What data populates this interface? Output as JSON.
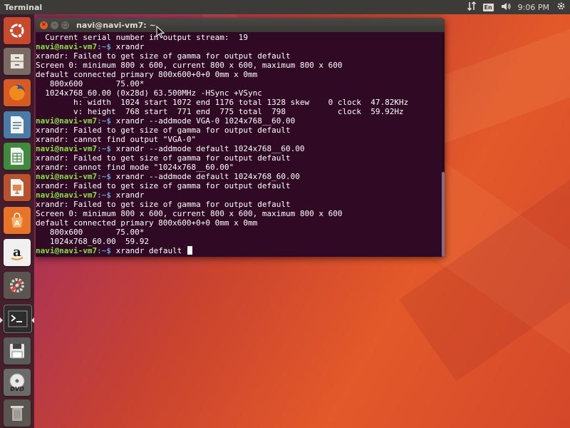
{
  "top_panel": {
    "app_title": "Terminal",
    "keyboard_layout": "En",
    "clock": "9:06 PM",
    "icons": [
      "network-transfer-icon",
      "keyboard-layout-icon",
      "volume-icon",
      "settings-gear-icon"
    ]
  },
  "launcher": {
    "items": [
      {
        "name": "ubuntu-dash",
        "icon": "ubuntu-logo-icon"
      },
      {
        "name": "files",
        "icon": "file-cabinet-icon"
      },
      {
        "name": "firefox",
        "icon": "firefox-icon"
      },
      {
        "name": "libreoffice-writer",
        "icon": "writer-document-icon"
      },
      {
        "name": "libreoffice-calc",
        "icon": "calc-spreadsheet-icon"
      },
      {
        "name": "libreoffice-impress",
        "icon": "impress-presentation-icon"
      },
      {
        "name": "ubuntu-software",
        "icon": "software-center-icon"
      },
      {
        "name": "amazon",
        "icon": "amazon-icon"
      },
      {
        "name": "system-settings",
        "icon": "settings-tools-icon"
      },
      {
        "name": "terminal",
        "icon": "terminal-icon"
      },
      {
        "name": "save-disk",
        "icon": "floppy-disk-icon"
      },
      {
        "name": "dvd",
        "icon": "dvd-icon",
        "label": "DVD"
      },
      {
        "name": "trash",
        "icon": "trash-icon"
      }
    ]
  },
  "terminal": {
    "title": "navi@navi-vm7: ~",
    "prompt_user": "navi@navi-vm7",
    "prompt_path": ":~$",
    "lines": [
      {
        "type": "out",
        "text": "  Current serial number in output stream:  19"
      },
      {
        "type": "cmd",
        "text": " xrandr"
      },
      {
        "type": "out",
        "text": "xrandr: Failed to get size of gamma for output default"
      },
      {
        "type": "out",
        "text": "Screen 0: minimum 800 x 600, current 800 x 600, maximum 800 x 600"
      },
      {
        "type": "out",
        "text": "default connected primary 800x600+0+0 0mm x 0mm"
      },
      {
        "type": "out",
        "text": "   800x600       75.00*"
      },
      {
        "type": "out",
        "text": "  1024x768_60.00 (0x28d) 63.500MHz -HSync +VSync"
      },
      {
        "type": "out",
        "text": "        h: width  1024 start 1072 end 1176 total 1328 skew    0 clock  47.82KHz"
      },
      {
        "type": "out",
        "text": "        v: height  768 start  771 end  775 total  798           clock  59.92Hz"
      },
      {
        "type": "cmd",
        "text": " xrandr --addmode VGA-0 1024x768__60.00"
      },
      {
        "type": "out",
        "text": "xrandr: Failed to get size of gamma for output default"
      },
      {
        "type": "out",
        "text": "xrandr: cannot find output \"VGA-0\""
      },
      {
        "type": "cmd",
        "text": " xrandr --addmode default 1024x768__60.00"
      },
      {
        "type": "out",
        "text": "xrandr: Failed to get size of gamma for output default"
      },
      {
        "type": "out",
        "text": "xrandr: cannot find mode \"1024x768__60.00\""
      },
      {
        "type": "cmd",
        "text": " xrandr --addmode default 1024x768_60.00"
      },
      {
        "type": "out",
        "text": "xrandr: Failed to get size of gamma for output default"
      },
      {
        "type": "cmd",
        "text": " xrandr"
      },
      {
        "type": "out",
        "text": "xrandr: Failed to get size of gamma for output default"
      },
      {
        "type": "out",
        "text": "Screen 0: minimum 800 x 600, current 800 x 600, maximum 800 x 600"
      },
      {
        "type": "out",
        "text": "default connected primary 800x600+0+0 0mm x 0mm"
      },
      {
        "type": "out",
        "text": "   800x600       75.00*"
      },
      {
        "type": "out",
        "text": "   1024x768_60.00  59.92"
      },
      {
        "type": "cmd",
        "text": " xrandr default ",
        "cursor": true
      }
    ]
  },
  "colors": {
    "terminal_bg": "#300a24",
    "prompt_user": "#8ae234",
    "prompt_path": "#729fcf",
    "panel_bg": "#3c3b37"
  }
}
